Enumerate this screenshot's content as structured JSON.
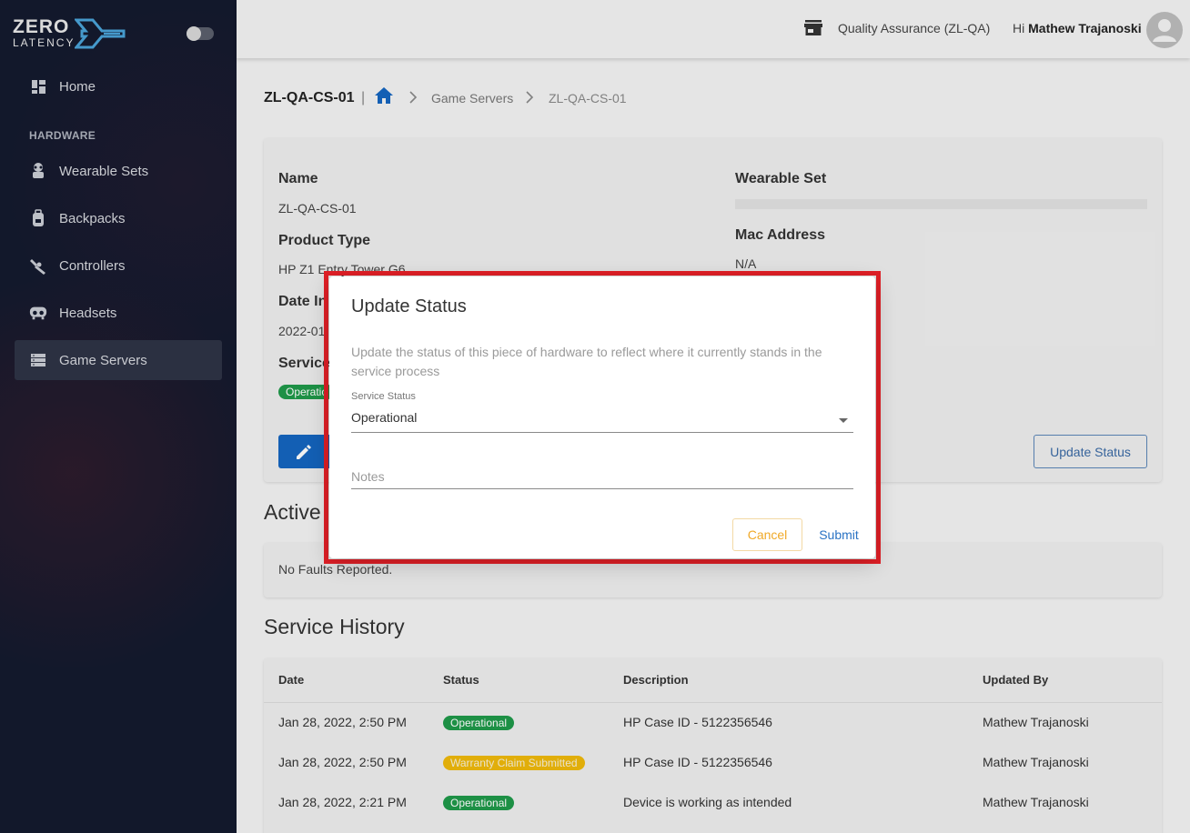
{
  "sidebar": {
    "logo_top": "ZERO",
    "logo_bottom": "LATENCY",
    "section_label": "HARDWARE",
    "items": [
      {
        "label": "Home",
        "icon": "dashboard-icon"
      },
      {
        "label": "Wearable Sets",
        "icon": "wearable-icon"
      },
      {
        "label": "Backpacks",
        "icon": "backpack-icon"
      },
      {
        "label": "Controllers",
        "icon": "controller-icon"
      },
      {
        "label": "Headsets",
        "icon": "headset-icon"
      },
      {
        "label": "Game Servers",
        "icon": "server-icon"
      }
    ]
  },
  "header": {
    "org": "Quality Assurance (ZL-QA)",
    "greeting_prefix": "Hi ",
    "user_name": "Mathew Trajanoski"
  },
  "breadcrumb": {
    "title": "ZL-QA-CS-01",
    "separator": "|",
    "link1": "Game Servers",
    "link2": "ZL-QA-CS-01"
  },
  "details": {
    "name_label": "Name",
    "name_value": "ZL-QA-CS-01",
    "product_type_label": "Product Type",
    "product_type_value": "HP Z1 Entry Tower G6",
    "date_label": "Date In",
    "date_value": "2022-01",
    "service_label": "Service",
    "service_chip": "Operatio",
    "wearable_set_label": "Wearable Set",
    "mac_label": "Mac Address",
    "mac_value": "N/A",
    "update_status_button": "Update Status"
  },
  "faults": {
    "title": "Active",
    "empty_text": "No Faults Reported."
  },
  "service_history": {
    "title": "Service History",
    "columns": [
      "Date",
      "Status",
      "Description",
      "Updated By"
    ],
    "rows": [
      {
        "date": "Jan 28, 2022, 2:50 PM",
        "status": "Operational",
        "status_color": "#1f9a4a",
        "description": "HP Case ID - 5122356546",
        "updated_by": "Mathew Trajanoski"
      },
      {
        "date": "Jan 28, 2022, 2:50 PM",
        "status": "Warranty Claim Submitted",
        "status_color": "#f0b90b",
        "description": "HP Case ID - 5122356546",
        "updated_by": "Mathew Trajanoski"
      },
      {
        "date": "Jan 28, 2022, 2:21 PM",
        "status": "Operational",
        "status_color": "#1f9a4a",
        "description": "Device is working as intended",
        "updated_by": "Mathew Trajanoski"
      }
    ]
  },
  "dialog": {
    "title": "Update Status",
    "description": "Update the status of this piece of hardware to reflect where it currently stands in the service process",
    "select_label": "Service Status",
    "select_value": "Operational",
    "notes_placeholder": "Notes",
    "cancel_label": "Cancel",
    "submit_label": "Submit"
  },
  "colors": {
    "sidebar_bg": "#141a2e",
    "primary": "#1565c0",
    "highlight": "#e01f26",
    "cancel": "#f0a928",
    "operational": "#1f9a4a",
    "warranty": "#f0b90b"
  }
}
